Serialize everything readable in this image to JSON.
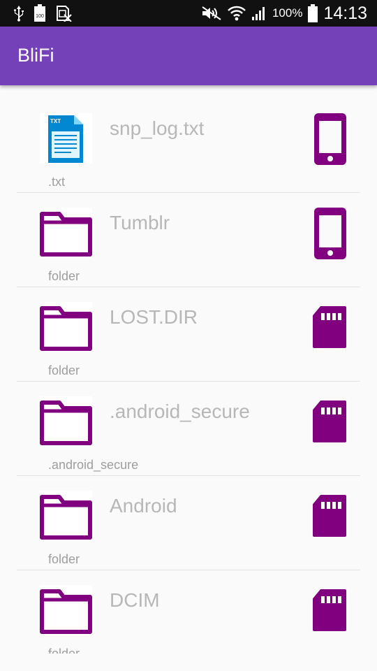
{
  "status_bar": {
    "battery_percent": "100%",
    "time": "14:13",
    "icons_left": [
      "usb-icon",
      "battery-100-icon",
      "blocked-sim-icon"
    ],
    "icons_right": [
      "mute-icon",
      "wifi-icon",
      "signal-icon",
      "battery-icon"
    ]
  },
  "app_bar": {
    "title": "BliFi",
    "color": "#7441b8"
  },
  "accent": "#800080",
  "files": [
    {
      "name": "snp_log.txt",
      "subtitle": ".txt",
      "thumb": "txt-file-icon",
      "location": "phone-icon"
    },
    {
      "name": "Tumblr",
      "subtitle": "folder",
      "thumb": "folder-icon",
      "location": "phone-icon"
    },
    {
      "name": "LOST.DIR",
      "subtitle": "folder",
      "thumb": "folder-icon",
      "location": "sd-card-icon"
    },
    {
      "name": ".android_secure",
      "subtitle": ".android_secure",
      "thumb": "folder-icon",
      "location": "sd-card-icon"
    },
    {
      "name": "Android",
      "subtitle": "folder",
      "thumb": "folder-icon",
      "location": "sd-card-icon"
    },
    {
      "name": "DCIM",
      "subtitle": "folder",
      "thumb": "folder-icon",
      "location": "sd-card-icon"
    }
  ]
}
